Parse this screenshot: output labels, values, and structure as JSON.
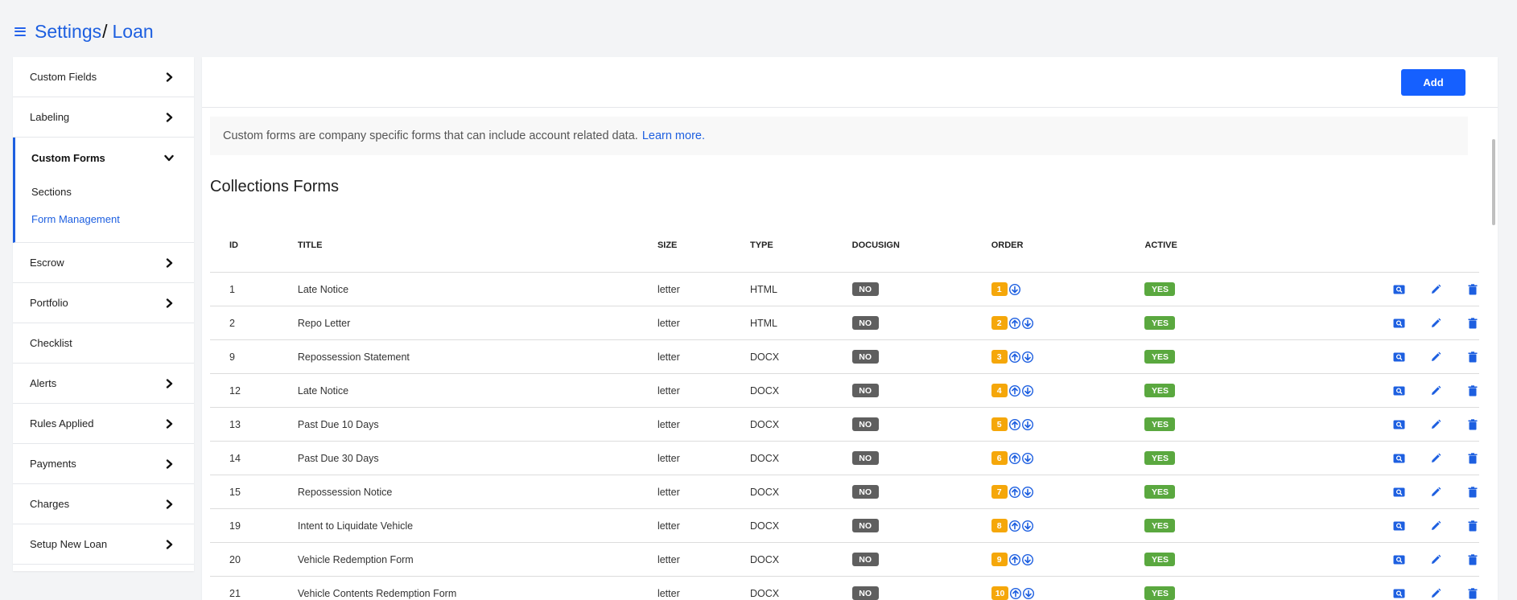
{
  "header": {
    "breadcrumb": [
      "Settings",
      "Loan"
    ],
    "separator": "/"
  },
  "colors": {
    "primary": "#1d5fe0",
    "no_badge": "#5f5f5f",
    "yes_badge": "#5aa83f",
    "order_badge": "#f5a70a"
  },
  "sidebar": {
    "items_top": [
      {
        "label": "Custom Fields",
        "chevron": "chevron-right-icon"
      },
      {
        "label": "Labeling",
        "chevron": "chevron-right-icon"
      }
    ],
    "expanded": {
      "label": "Custom Forms",
      "chevron": "chevron-down-icon",
      "subitems": [
        {
          "label": "Sections",
          "active": false
        },
        {
          "label": "Form Management",
          "active": true
        }
      ]
    },
    "items_bottom": [
      {
        "label": "Escrow",
        "chevron": "chevron-right-icon"
      },
      {
        "label": "Portfolio",
        "chevron": "chevron-right-icon"
      },
      {
        "label": "Checklist",
        "chevron": ""
      },
      {
        "label": "Alerts",
        "chevron": "chevron-right-icon"
      },
      {
        "label": "Rules Applied",
        "chevron": "chevron-right-icon"
      },
      {
        "label": "Payments",
        "chevron": "chevron-right-icon"
      },
      {
        "label": "Charges",
        "chevron": "chevron-right-icon"
      },
      {
        "label": "Setup New Loan",
        "chevron": "chevron-right-icon"
      }
    ]
  },
  "main": {
    "add_label": "Add",
    "info_text": "Custom forms are company specific forms that can include account related data.",
    "info_link": "Learn more.",
    "section_title": "Collections Forms",
    "columns": [
      "ID",
      "TITLE",
      "SIZE",
      "TYPE",
      "DOCUSIGN",
      "ORDER",
      "ACTIVE"
    ],
    "rows": [
      {
        "id": "1",
        "title": "Late Notice",
        "size": "letter",
        "type": "HTML",
        "docusign": "NO",
        "order": "1",
        "active": "YES"
      },
      {
        "id": "2",
        "title": "Repo Letter",
        "size": "letter",
        "type": "HTML",
        "docusign": "NO",
        "order": "2",
        "active": "YES"
      },
      {
        "id": "9",
        "title": "Repossession Statement",
        "size": "letter",
        "type": "DOCX",
        "docusign": "NO",
        "order": "3",
        "active": "YES"
      },
      {
        "id": "12",
        "title": "Late Notice",
        "size": "letter",
        "type": "DOCX",
        "docusign": "NO",
        "order": "4",
        "active": "YES"
      },
      {
        "id": "13",
        "title": "Past Due 10 Days",
        "size": "letter",
        "type": "DOCX",
        "docusign": "NO",
        "order": "5",
        "active": "YES"
      },
      {
        "id": "14",
        "title": "Past Due 30 Days",
        "size": "letter",
        "type": "DOCX",
        "docusign": "NO",
        "order": "6",
        "active": "YES"
      },
      {
        "id": "15",
        "title": "Repossession Notice",
        "size": "letter",
        "type": "DOCX",
        "docusign": "NO",
        "order": "7",
        "active": "YES"
      },
      {
        "id": "19",
        "title": "Intent to Liquidate Vehicle",
        "size": "letter",
        "type": "DOCX",
        "docusign": "NO",
        "order": "8",
        "active": "YES"
      },
      {
        "id": "20",
        "title": "Vehicle Redemption Form",
        "size": "letter",
        "type": "DOCX",
        "docusign": "NO",
        "order": "9",
        "active": "YES"
      },
      {
        "id": "21",
        "title": "Vehicle Contents Redemption Form",
        "size": "letter",
        "type": "DOCX",
        "docusign": "NO",
        "order": "10",
        "active": "YES"
      }
    ]
  }
}
